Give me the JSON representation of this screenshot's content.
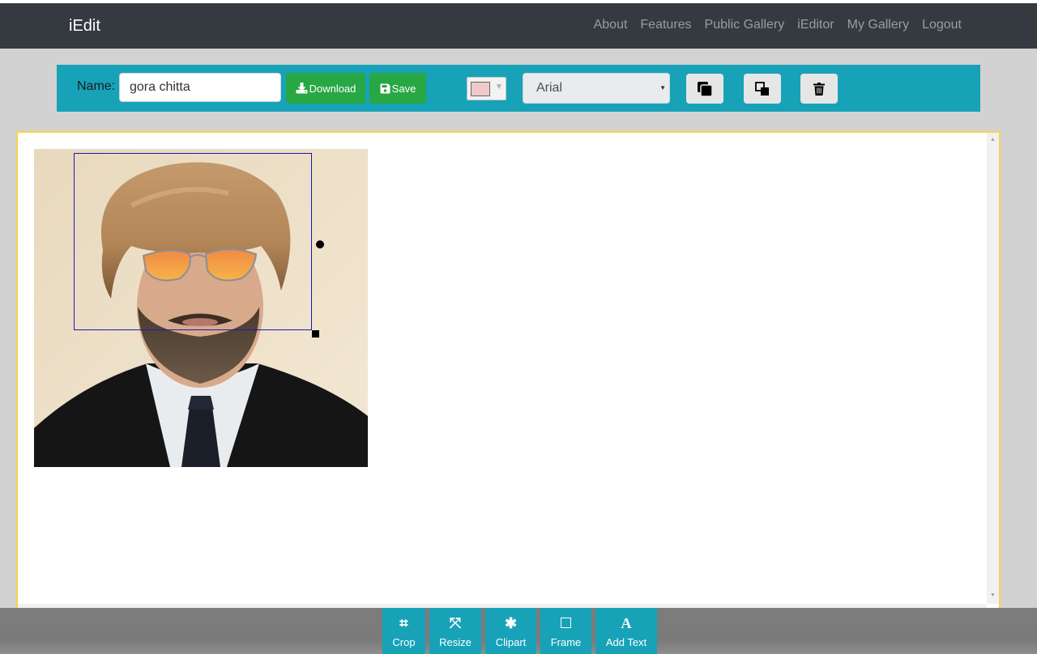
{
  "navbar": {
    "brand": "iEdit",
    "links": [
      "About",
      "Features",
      "Public Gallery",
      "iEditor",
      "My Gallery",
      "Logout"
    ]
  },
  "toolbar": {
    "name_label": "Name:",
    "name_value": "gora chitta",
    "download_label": "Download",
    "save_label": "Save",
    "text_color": "#f0c8c8",
    "font_value": "Arial",
    "bring_forward_icon": "bring-forward-icon",
    "send_backward_icon": "send-backward-icon",
    "delete_icon": "trash-icon"
  },
  "bottom_tools": [
    {
      "label": "Crop",
      "icon": "crop-icon"
    },
    {
      "label": "Resize",
      "icon": "expand-icon"
    },
    {
      "label": "Clipart",
      "icon": "asterisk-icon"
    },
    {
      "label": "Frame",
      "icon": "square-icon"
    },
    {
      "label": "Add Text",
      "icon": "font-icon"
    }
  ],
  "colors": {
    "navbar": "#343a40",
    "toolbar": "#17a2b8",
    "green": "#28a745",
    "canvas_border": "#f5d547"
  }
}
